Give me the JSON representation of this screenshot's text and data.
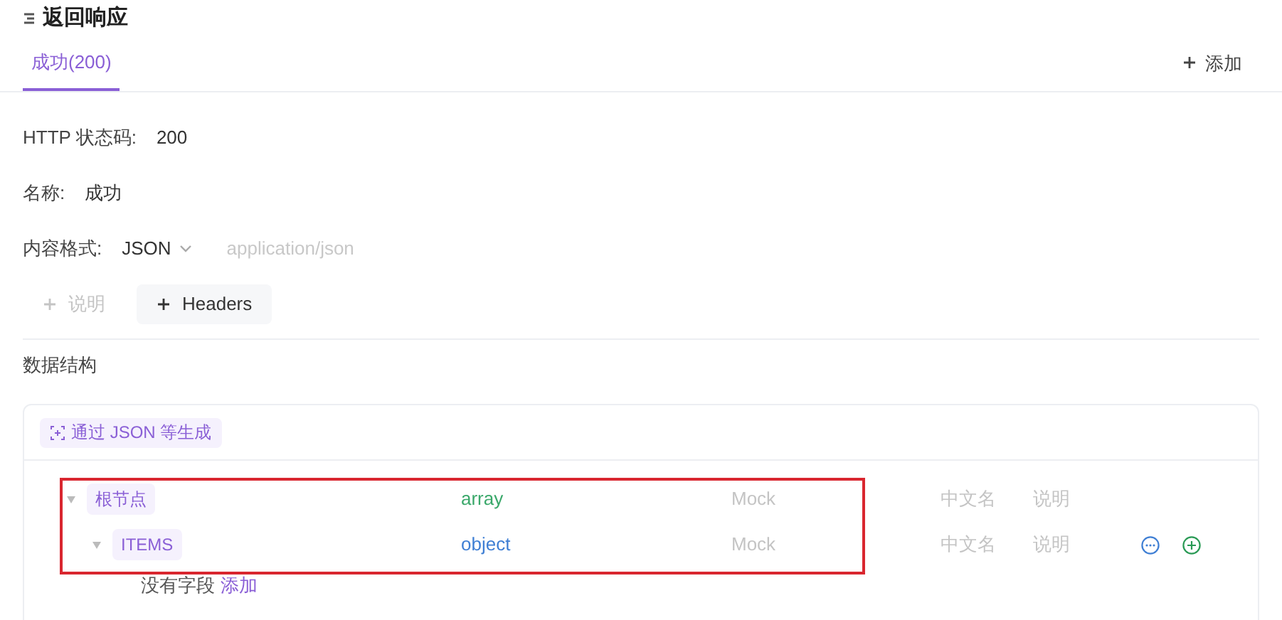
{
  "section_title": "返回响应",
  "tabs": [
    {
      "label": "成功(200)",
      "selected": true
    }
  ],
  "add_button": "添加",
  "fields": [
    {
      "label": "HTTP 状态码:",
      "value": "200"
    },
    {
      "label": "名称:",
      "value": "成功"
    }
  ],
  "content_format": {
    "label": "内容格式:",
    "value": "JSON",
    "placeholder": "application/json"
  },
  "extra_buttons": [
    {
      "label": "说明",
      "disabled": true
    },
    {
      "label": "Headers",
      "disabled": false
    }
  ],
  "schema": {
    "title": "数据结构",
    "generate_button": "通过 JSON 等生成",
    "tree": [
      {
        "name": "根节点",
        "type": "array",
        "color": "#3aa86a",
        "mock": "Mock",
        "cn_name": "中文名",
        "description": "说明",
        "expanded": true,
        "show_actions": false,
        "children": [
          {
            "name": "ITEMS",
            "type": "object",
            "color": "#3f7fd4",
            "mock": "Mock",
            "cn_name": "中文名",
            "description": "说明",
            "expanded": true,
            "show_actions": true,
            "empty_text": "没有字段",
            "empty_link": "添加"
          }
        ]
      }
    ]
  }
}
